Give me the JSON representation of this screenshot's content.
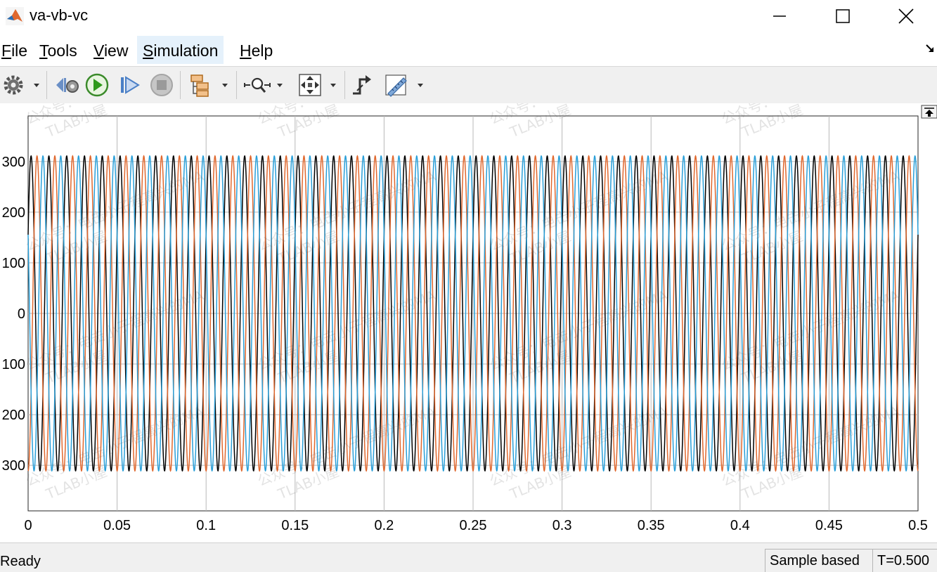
{
  "window": {
    "title": "va-vb-vc",
    "minimize_label": "—",
    "maximize_label": "☐",
    "close_label": "✕"
  },
  "menu": {
    "items": [
      {
        "label": "File",
        "mnemonic": "F",
        "rest": "ile"
      },
      {
        "label": "Tools",
        "mnemonic": "T",
        "rest": "ools"
      },
      {
        "label": "View",
        "mnemonic": "V",
        "rest": "iew"
      },
      {
        "label": "Simulation",
        "mnemonic": "S",
        "rest": "imulation"
      },
      {
        "label": "Help",
        "mnemonic": "H",
        "rest": "elp"
      }
    ]
  },
  "toolbar": {
    "icons": [
      "settings-gear-icon",
      "step-back-icon",
      "run-icon",
      "step-forward-icon",
      "stop-icon",
      "signal-hierarchy-icon",
      "zoom-icon",
      "fit-to-view-icon",
      "triggers-icon",
      "measurements-ruler-icon"
    ]
  },
  "chart_data": {
    "type": "line",
    "title": "",
    "xlabel": "",
    "ylabel": "",
    "xlim": [
      0,
      0.5
    ],
    "ylim": [
      -390,
      390
    ],
    "xticks": [
      0,
      0.05,
      0.1,
      0.15,
      0.2,
      0.25,
      0.3,
      0.35,
      0.4,
      0.45,
      0.5
    ],
    "xtick_labels": [
      "0",
      "0.05",
      "0.1",
      "0.15",
      "0.2",
      "0.25",
      "0.3",
      "0.35",
      "0.4",
      "0.45",
      "0.5"
    ],
    "yticks": [
      300,
      200,
      100,
      0,
      -100,
      -200,
      -300
    ],
    "ytick_labels": [
      "300",
      "200",
      "100",
      "0",
      "100",
      "200",
      "300"
    ],
    "grid": true,
    "series": [
      {
        "amplitude": 311,
        "frequency_hz": 100,
        "phase_deg": 30,
        "color": "#000000"
      },
      {
        "amplitude": 311,
        "frequency_hz": 100,
        "phase_deg": -90,
        "color": "#e0682e"
      },
      {
        "amplitude": 311,
        "frequency_hz": 100,
        "phase_deg": 150,
        "color": "#2a9fd8"
      }
    ]
  },
  "status": {
    "text": "Ready",
    "sample_mode": "Sample based",
    "time": "T=0.500"
  },
  "watermark": {
    "lines": [
      "公众号：电击小子程高兴的MA",
      "TLAB小屋"
    ]
  }
}
